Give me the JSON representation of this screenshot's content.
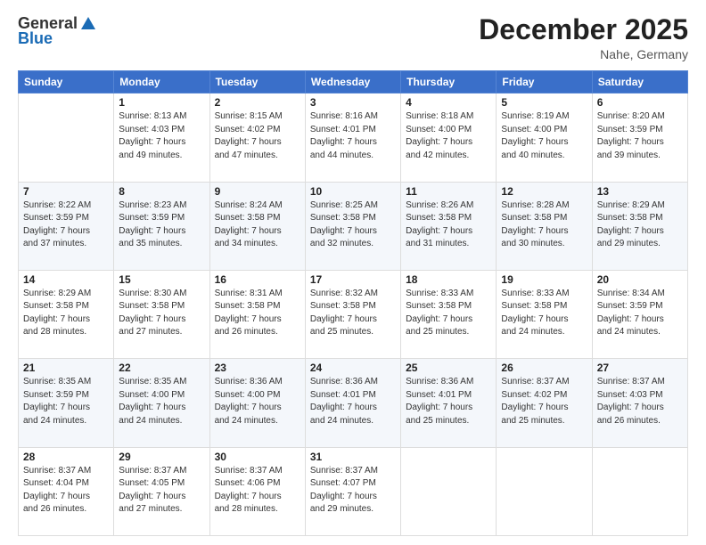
{
  "header": {
    "logo_general": "General",
    "logo_blue": "Blue",
    "month_title": "December 2025",
    "location": "Nahe, Germany"
  },
  "days_of_week": [
    "Sunday",
    "Monday",
    "Tuesday",
    "Wednesday",
    "Thursday",
    "Friday",
    "Saturday"
  ],
  "weeks": [
    [
      {
        "day": "",
        "info": ""
      },
      {
        "day": "1",
        "info": "Sunrise: 8:13 AM\nSunset: 4:03 PM\nDaylight: 7 hours\nand 49 minutes."
      },
      {
        "day": "2",
        "info": "Sunrise: 8:15 AM\nSunset: 4:02 PM\nDaylight: 7 hours\nand 47 minutes."
      },
      {
        "day": "3",
        "info": "Sunrise: 8:16 AM\nSunset: 4:01 PM\nDaylight: 7 hours\nand 44 minutes."
      },
      {
        "day": "4",
        "info": "Sunrise: 8:18 AM\nSunset: 4:00 PM\nDaylight: 7 hours\nand 42 minutes."
      },
      {
        "day": "5",
        "info": "Sunrise: 8:19 AM\nSunset: 4:00 PM\nDaylight: 7 hours\nand 40 minutes."
      },
      {
        "day": "6",
        "info": "Sunrise: 8:20 AM\nSunset: 3:59 PM\nDaylight: 7 hours\nand 39 minutes."
      }
    ],
    [
      {
        "day": "7",
        "info": "Sunrise: 8:22 AM\nSunset: 3:59 PM\nDaylight: 7 hours\nand 37 minutes."
      },
      {
        "day": "8",
        "info": "Sunrise: 8:23 AM\nSunset: 3:59 PM\nDaylight: 7 hours\nand 35 minutes."
      },
      {
        "day": "9",
        "info": "Sunrise: 8:24 AM\nSunset: 3:58 PM\nDaylight: 7 hours\nand 34 minutes."
      },
      {
        "day": "10",
        "info": "Sunrise: 8:25 AM\nSunset: 3:58 PM\nDaylight: 7 hours\nand 32 minutes."
      },
      {
        "day": "11",
        "info": "Sunrise: 8:26 AM\nSunset: 3:58 PM\nDaylight: 7 hours\nand 31 minutes."
      },
      {
        "day": "12",
        "info": "Sunrise: 8:28 AM\nSunset: 3:58 PM\nDaylight: 7 hours\nand 30 minutes."
      },
      {
        "day": "13",
        "info": "Sunrise: 8:29 AM\nSunset: 3:58 PM\nDaylight: 7 hours\nand 29 minutes."
      }
    ],
    [
      {
        "day": "14",
        "info": "Sunrise: 8:29 AM\nSunset: 3:58 PM\nDaylight: 7 hours\nand 28 minutes."
      },
      {
        "day": "15",
        "info": "Sunrise: 8:30 AM\nSunset: 3:58 PM\nDaylight: 7 hours\nand 27 minutes."
      },
      {
        "day": "16",
        "info": "Sunrise: 8:31 AM\nSunset: 3:58 PM\nDaylight: 7 hours\nand 26 minutes."
      },
      {
        "day": "17",
        "info": "Sunrise: 8:32 AM\nSunset: 3:58 PM\nDaylight: 7 hours\nand 25 minutes."
      },
      {
        "day": "18",
        "info": "Sunrise: 8:33 AM\nSunset: 3:58 PM\nDaylight: 7 hours\nand 25 minutes."
      },
      {
        "day": "19",
        "info": "Sunrise: 8:33 AM\nSunset: 3:58 PM\nDaylight: 7 hours\nand 24 minutes."
      },
      {
        "day": "20",
        "info": "Sunrise: 8:34 AM\nSunset: 3:59 PM\nDaylight: 7 hours\nand 24 minutes."
      }
    ],
    [
      {
        "day": "21",
        "info": "Sunrise: 8:35 AM\nSunset: 3:59 PM\nDaylight: 7 hours\nand 24 minutes."
      },
      {
        "day": "22",
        "info": "Sunrise: 8:35 AM\nSunset: 4:00 PM\nDaylight: 7 hours\nand 24 minutes."
      },
      {
        "day": "23",
        "info": "Sunrise: 8:36 AM\nSunset: 4:00 PM\nDaylight: 7 hours\nand 24 minutes."
      },
      {
        "day": "24",
        "info": "Sunrise: 8:36 AM\nSunset: 4:01 PM\nDaylight: 7 hours\nand 24 minutes."
      },
      {
        "day": "25",
        "info": "Sunrise: 8:36 AM\nSunset: 4:01 PM\nDaylight: 7 hours\nand 25 minutes."
      },
      {
        "day": "26",
        "info": "Sunrise: 8:37 AM\nSunset: 4:02 PM\nDaylight: 7 hours\nand 25 minutes."
      },
      {
        "day": "27",
        "info": "Sunrise: 8:37 AM\nSunset: 4:03 PM\nDaylight: 7 hours\nand 26 minutes."
      }
    ],
    [
      {
        "day": "28",
        "info": "Sunrise: 8:37 AM\nSunset: 4:04 PM\nDaylight: 7 hours\nand 26 minutes."
      },
      {
        "day": "29",
        "info": "Sunrise: 8:37 AM\nSunset: 4:05 PM\nDaylight: 7 hours\nand 27 minutes."
      },
      {
        "day": "30",
        "info": "Sunrise: 8:37 AM\nSunset: 4:06 PM\nDaylight: 7 hours\nand 28 minutes."
      },
      {
        "day": "31",
        "info": "Sunrise: 8:37 AM\nSunset: 4:07 PM\nDaylight: 7 hours\nand 29 minutes."
      },
      {
        "day": "",
        "info": ""
      },
      {
        "day": "",
        "info": ""
      },
      {
        "day": "",
        "info": ""
      }
    ]
  ]
}
